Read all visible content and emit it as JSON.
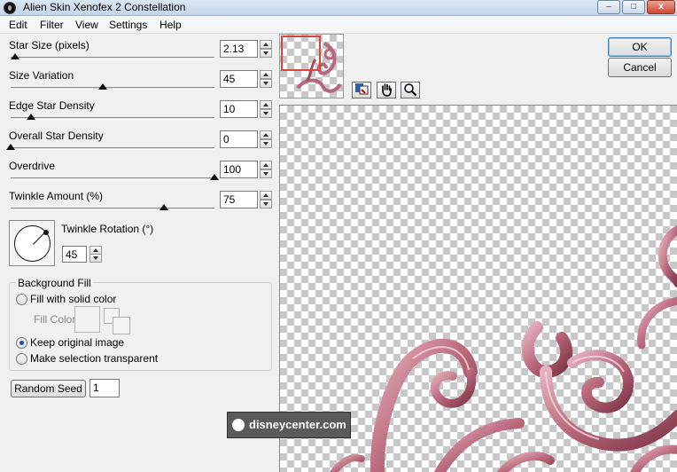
{
  "window": {
    "title": "Alien Skin Xenofex 2 Constellation",
    "minimize_glyph": "–",
    "maximize_glyph": "□",
    "close_glyph": "x"
  },
  "menu": [
    "Edit",
    "Filter",
    "View",
    "Settings",
    "Help"
  ],
  "params": {
    "star_size": {
      "label": "Star Size (pixels)",
      "value": "2.13",
      "level": 0.02
    },
    "size_variation": {
      "label": "Size Variation",
      "value": "45",
      "level": 0.45
    },
    "edge_star_density": {
      "label": "Edge Star Density",
      "value": "10",
      "level": 0.1
    },
    "overall_star_density": {
      "label": "Overall Star Density",
      "value": "0",
      "level": 0.0
    },
    "overdrive": {
      "label": "Overdrive",
      "value": "100",
      "level": 1.0
    },
    "twinkle_amount": {
      "label": "Twinkle Amount (%)",
      "value": "75",
      "level": 0.75
    }
  },
  "twinkle_rotation": {
    "label": "Twinkle Rotation (°)",
    "value": "45",
    "angle_deg": 45
  },
  "background_fill": {
    "title": "Background Fill",
    "options": [
      {
        "label": "Fill with solid color",
        "selected": false
      },
      {
        "label": "Keep original image",
        "selected": true
      },
      {
        "label": "Make selection transparent",
        "selected": false
      }
    ],
    "fill_color_label": "Fill Color"
  },
  "random_seed": {
    "button_label": "Random Seed",
    "value": "1"
  },
  "actions": {
    "ok_label": "OK",
    "cancel_label": "Cancel"
  },
  "preview_tools": [
    "preview-toggle-icon",
    "hand-icon",
    "zoom-icon"
  ],
  "watermark": {
    "text": "disneycenter.com"
  },
  "colors": {
    "ornament": "#b8667a",
    "ornament_dark": "#7d3446",
    "thumbnail_frame": "#d8473e",
    "radio_dot": "#1b4f9e"
  }
}
